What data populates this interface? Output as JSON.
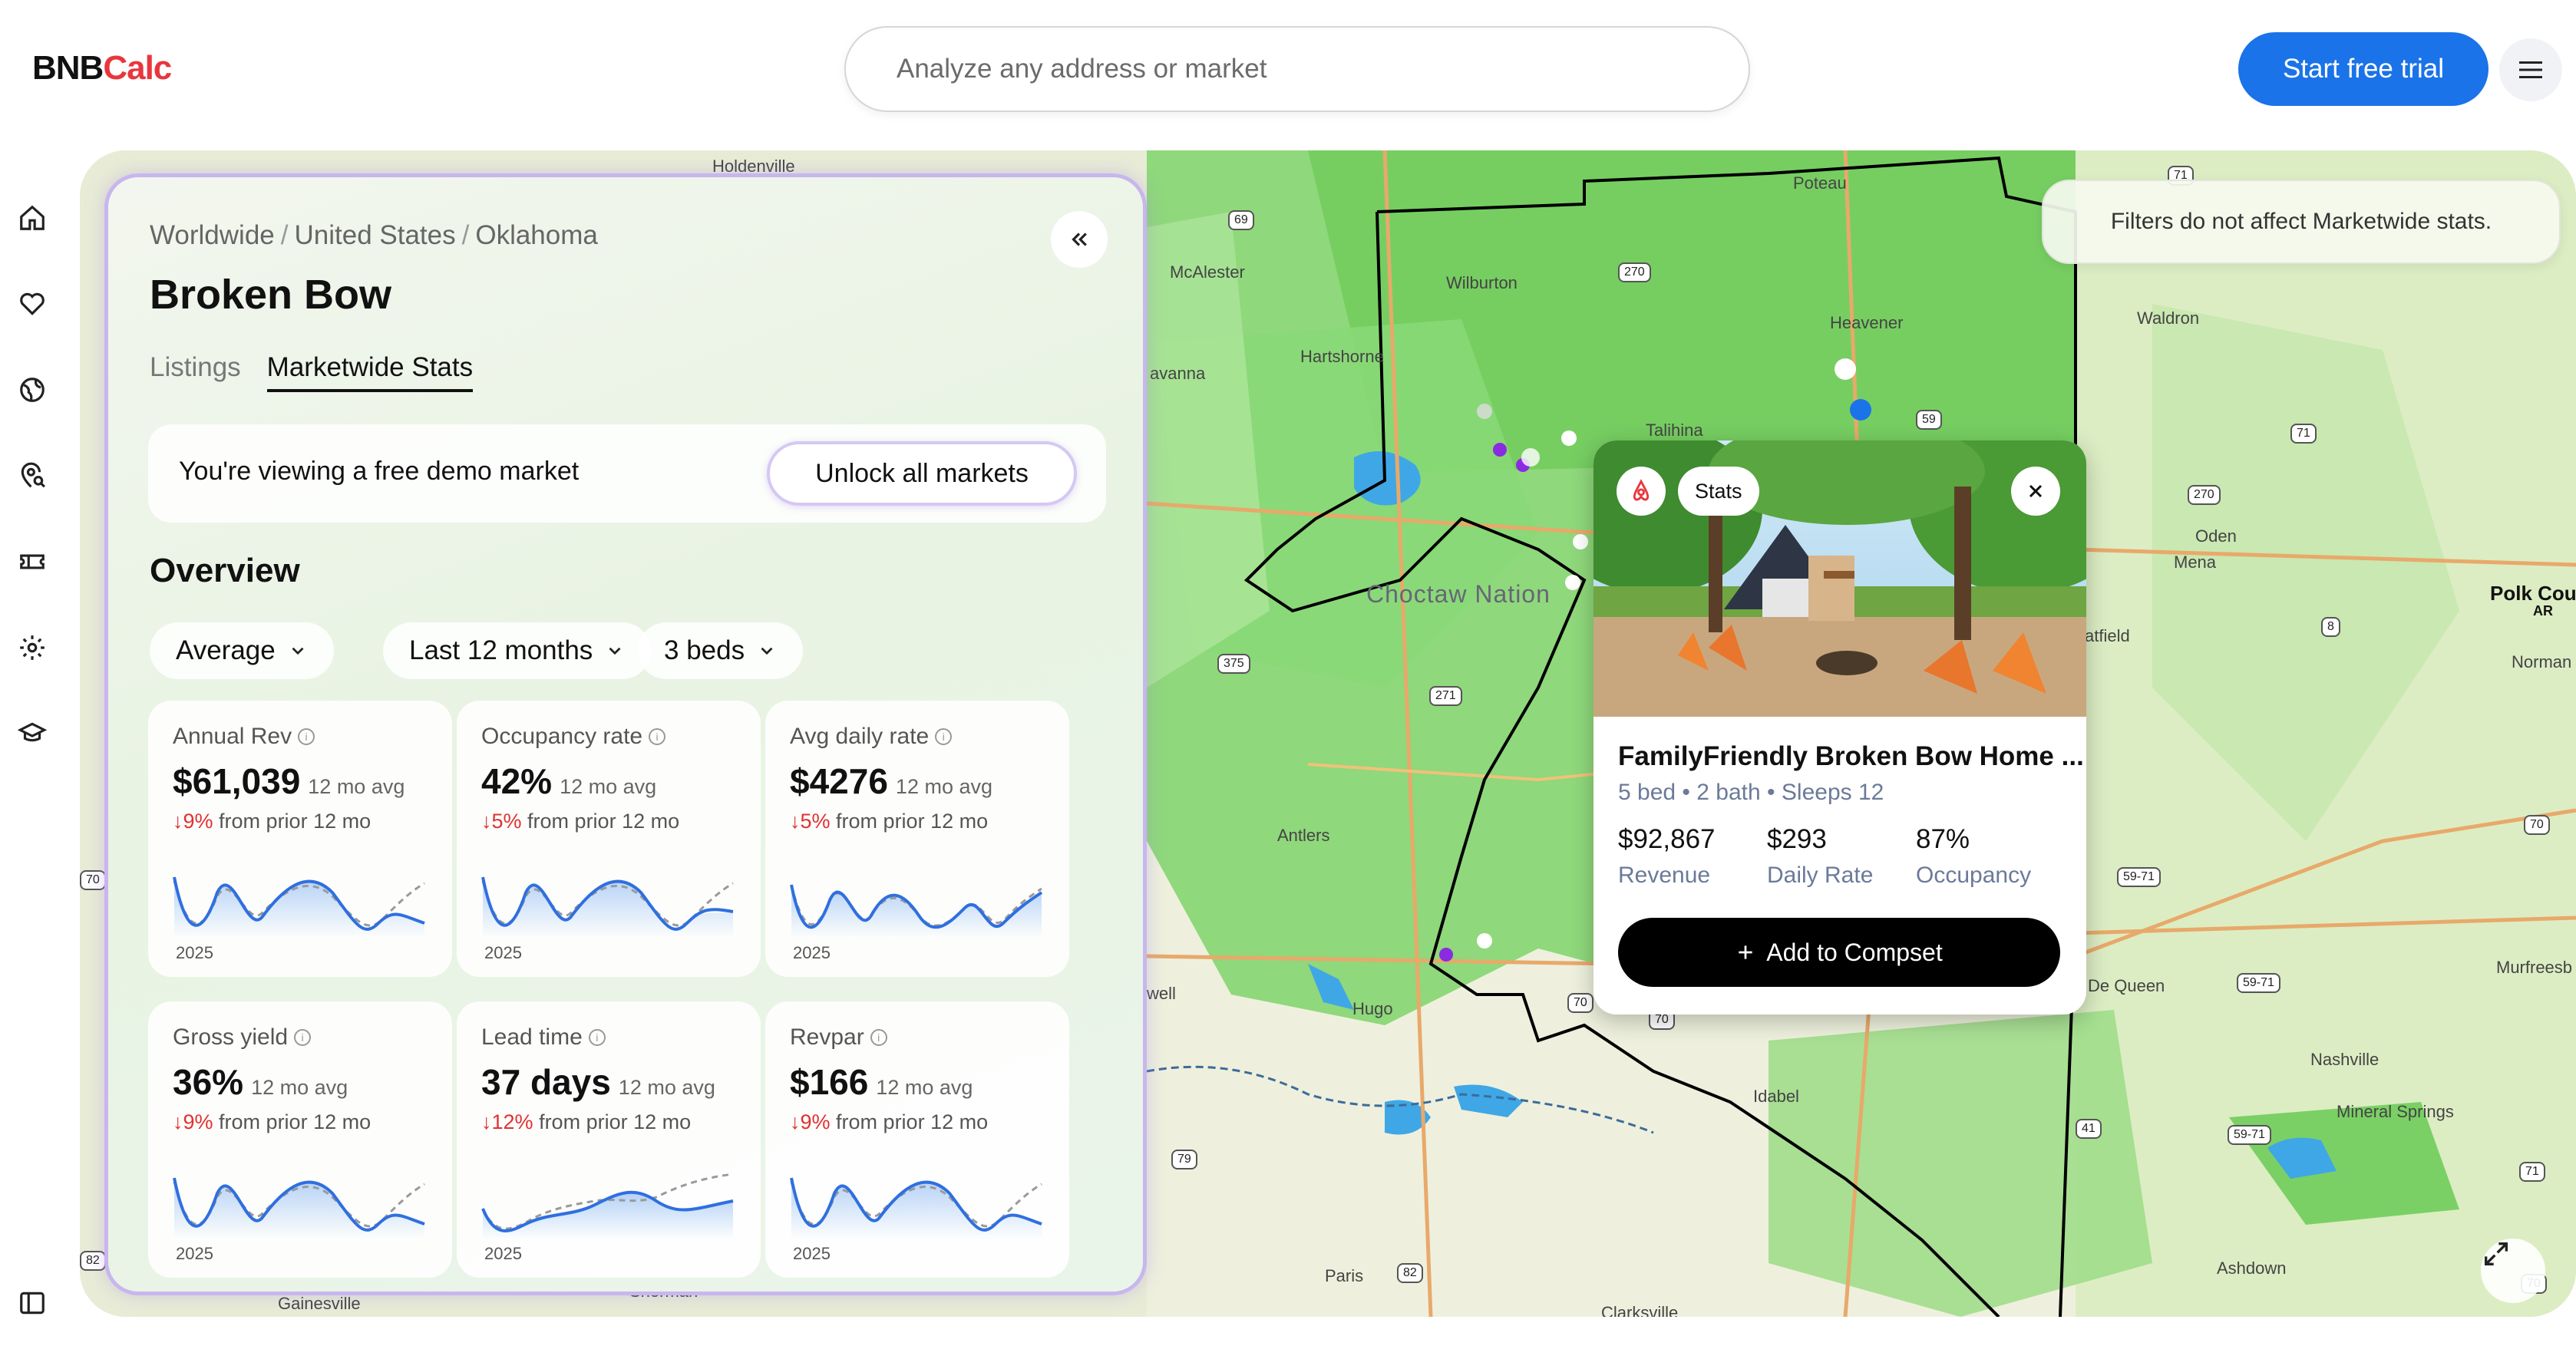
{
  "header": {
    "logo_part1": "BNB",
    "logo_part2": "Calc",
    "search_placeholder": "Analyze any address or market",
    "trial_label": "Start free trial"
  },
  "rail": {
    "icons": [
      "home-icon",
      "heart-icon",
      "globe-icon",
      "location-search-icon",
      "ticket-icon",
      "gear-icon",
      "graduation-cap-icon",
      "sidebar-toggle-icon"
    ]
  },
  "map": {
    "notice": "Filters do not affect Marketwide stats.",
    "labels": {
      "holdenville": "Holdenville",
      "poteau": "Poteau",
      "mcalester": "McAlester",
      "wilburton": "Wilburton",
      "heavener": "Heavener",
      "waldron": "Waldron",
      "hartshorne": "Hartshorne",
      "savanna": "avanna",
      "talihina": "Talihina",
      "choctaw": "Choctaw Nation",
      "mena": "Mena",
      "oden": "Oden",
      "polk": "Polk Cou",
      "polk_state": "AR",
      "hatfield": "atfield",
      "norman": "Norman",
      "antlers": "Antlers",
      "hugo": "Hugo",
      "idabel": "Idabel",
      "de_queen": "De Queen",
      "nashville": "Nashville",
      "murfreesboro": "Murfreesb",
      "mineral_springs": "Mineral Springs",
      "ashdown": "Ashdown",
      "paris": "Paris",
      "gainesville": "Gainesville",
      "sherman": "Sherman",
      "clarksville": "Clarksville",
      "well": "well"
    },
    "shields": {
      "s69": "69",
      "s270a": "270",
      "s59": "59",
      "s71a": "71",
      "s270b": "270",
      "s71b": "71",
      "s8": "8",
      "s375": "375",
      "s271": "271",
      "s70a": "70",
      "s70b": "70",
      "s70c": "70",
      "s5971a": "59-71",
      "s5971b": "59-71",
      "s5971c": "59-71",
      "s41": "41",
      "s79": "79",
      "s82a": "82",
      "s82b": "82",
      "s70d": "70",
      "s71c": "71",
      "s70e": "70"
    }
  },
  "panel": {
    "breadcrumb": [
      "Worldwide",
      "United States",
      "Oklahoma"
    ],
    "title": "Broken Bow",
    "tabs": [
      "Listings",
      "Marketwide Stats"
    ],
    "demo_text": "You're viewing a free demo market",
    "unlock_label": "Unlock all markets",
    "overview": "Overview",
    "filters": [
      "Average",
      "Last 12 months",
      "3 beds"
    ],
    "cards": [
      {
        "label": "Annual Rev",
        "value": "$61,039",
        "avg": "12 mo avg",
        "change": "↓9%",
        "change_text": "from prior 12 mo",
        "year": "2025"
      },
      {
        "label": "Occupancy rate",
        "value": "42%",
        "avg": "12 mo avg",
        "change": "↓5%",
        "change_text": "from prior 12 mo",
        "year": "2025"
      },
      {
        "label": "Avg daily rate",
        "value": "$4276",
        "avg": "12 mo avg",
        "change": "↓5%",
        "change_text": "from prior 12 mo",
        "year": "2025"
      },
      {
        "label": "Gross yield",
        "value": "36%",
        "avg": "12 mo avg",
        "change": "↓9%",
        "change_text": "from prior 12 mo",
        "year": "2025"
      },
      {
        "label": "Lead time",
        "value": "37 days",
        "avg": "12 mo avg",
        "change": "↓12%",
        "change_text": "from prior 12 mo",
        "year": "2025"
      },
      {
        "label": "Revpar",
        "value": "$166",
        "avg": "12 mo avg",
        "change": "↓9%",
        "change_text": "from prior 12 mo",
        "year": "2025"
      }
    ]
  },
  "popup": {
    "stats_label": "Stats",
    "title": "FamilyFriendly Broken Bow Home ...",
    "beds": "5 bed",
    "baths": "2 bath",
    "sleeps": "Sleeps 12",
    "dot": "•",
    "metrics": [
      {
        "value": "$92,867",
        "label": "Revenue"
      },
      {
        "value": "$293",
        "label": "Daily Rate"
      },
      {
        "value": "87%",
        "label": "Occupancy"
      }
    ],
    "compset_label": "Add to Compset"
  },
  "colors": {
    "brand_red": "#e8363c",
    "primary_blue": "#1a73e8",
    "decline_red": "#e03131",
    "panel_border": "#c8b6ee",
    "chart_line": "#2f6fe0",
    "chart_prior": "#9a9a9a",
    "forest_green": "#7ed36a"
  }
}
